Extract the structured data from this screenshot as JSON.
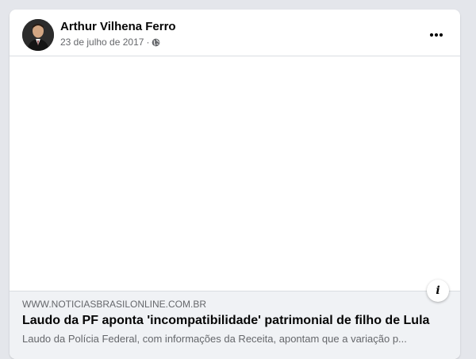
{
  "post": {
    "author_name": "Arthur Vilhena Ferro",
    "date": "23 de julho de 2017",
    "separator": "·",
    "privacy_icon": "globe-icon",
    "menu_icon": "more-horizontal-icon"
  },
  "link_preview": {
    "domain": "WWW.NOTICIASBRASILONLINE.COM.BR",
    "headline": "Laudo da PF aponta 'incompatibilidade' patrimonial de filho de Lula",
    "description": "Laudo da Polícia Federal, com informações da Receita, apontam que a variação p...",
    "info_icon": "info-icon"
  },
  "colors": {
    "background": "#e4e6eb",
    "card": "#ffffff",
    "preview_background": "#f0f2f5",
    "primary_text": "#050505",
    "secondary_text": "#65676b"
  }
}
